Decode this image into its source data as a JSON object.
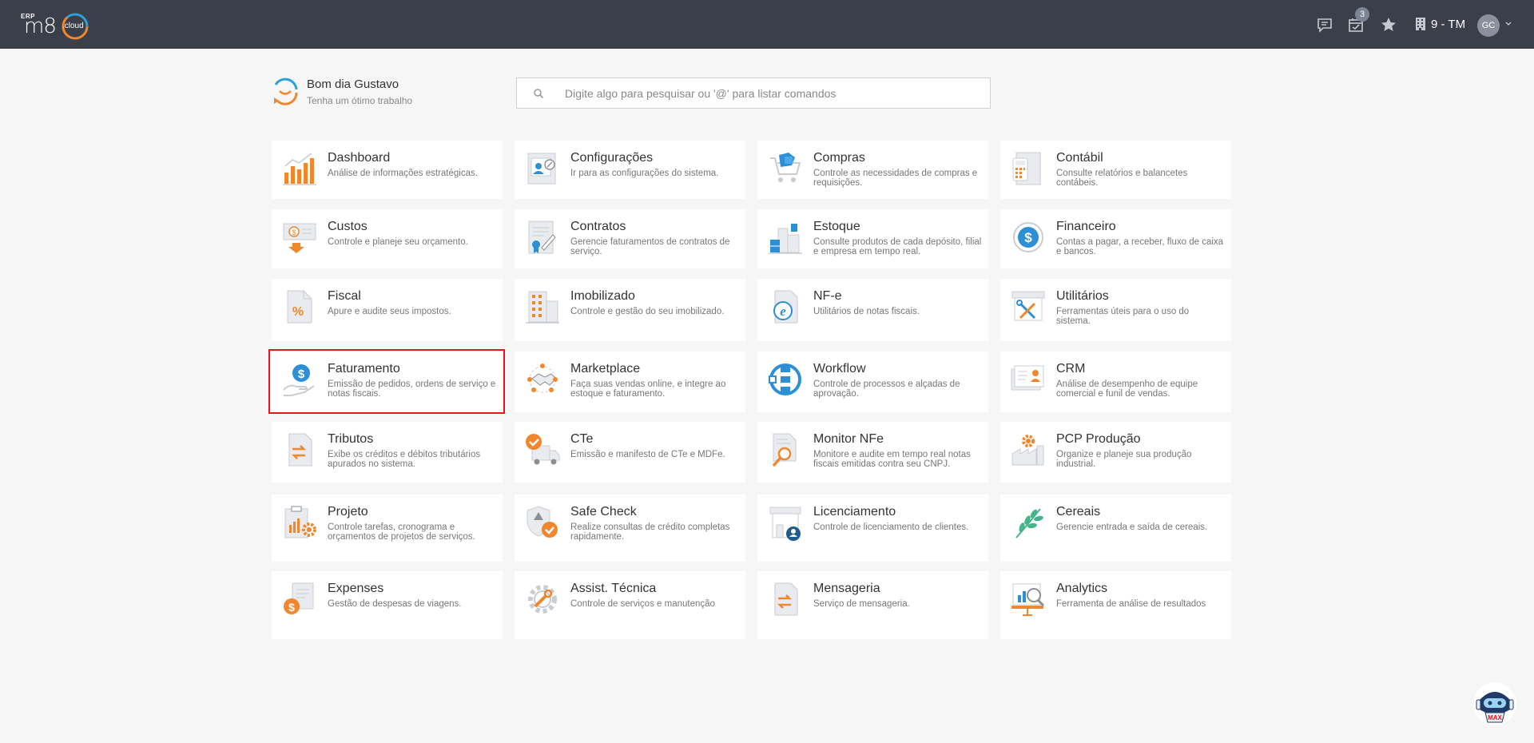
{
  "topbar": {
    "logo_erp": "ERP",
    "logo_name": "m8",
    "logo_cloud": ".cloud",
    "notification_count": "3",
    "company": "9 - TM",
    "avatar_initials": "GC",
    "background_color": "#3a3f4a"
  },
  "greeting": {
    "title": "Bom dia Gustavo",
    "subtitle": "Tenha um ótimo trabalho"
  },
  "search": {
    "placeholder": "Digite algo para pesquisar ou '@' para listar comandos"
  },
  "modules": [
    {
      "title": "Dashboard",
      "desc": "Análise de informações estratégicas.",
      "icon": "bar-chart-icon"
    },
    {
      "title": "Configurações",
      "desc": "Ir para as configurações do sistema.",
      "icon": "settings-doc-icon"
    },
    {
      "title": "Compras",
      "desc": "Controle as necessidades de compras e requisições.",
      "icon": "shopping-cart-icon"
    },
    {
      "title": "Contábil",
      "desc": "Consulte relatórios e balancetes contábeis.",
      "icon": "calculator-doc-icon"
    },
    {
      "title": "Custos",
      "desc": "Controle e planeje seu orçamento.",
      "icon": "money-down-icon"
    },
    {
      "title": "Contratos",
      "desc": "Gerencie faturamentos de contratos de serviço.",
      "icon": "contract-icon"
    },
    {
      "title": "Estoque",
      "desc": "Consulte produtos de cada depósito, filial e empresa em tempo real.",
      "icon": "warehouse-icon"
    },
    {
      "title": "Financeiro",
      "desc": "Contas a pagar, a receber, fluxo de caixa e bancos.",
      "icon": "dollar-circle-icon"
    },
    {
      "title": "Fiscal",
      "desc": "Apure e audite seus impostos.",
      "icon": "percent-doc-icon"
    },
    {
      "title": "Imobilizado",
      "desc": "Controle e gestão do seu imobilizado.",
      "icon": "building-icon"
    },
    {
      "title": "NF-e",
      "desc": "Utilitários de notas fiscais.",
      "icon": "e-doc-icon"
    },
    {
      "title": "Utilitários",
      "desc": "Ferramentas úteis para o uso do sistema.",
      "icon": "tools-icon"
    },
    {
      "title": "Faturamento",
      "desc": "Emissão de pedidos, ordens de serviço e notas fiscais.",
      "icon": "hand-dollar-icon"
    },
    {
      "title": "Marketplace",
      "desc": "Faça suas vendas online, e integre ao estoque e faturamento.",
      "icon": "handshake-icon"
    },
    {
      "title": "Workflow",
      "desc": "Controle de processos e alçadas de aprovação.",
      "icon": "workflow-icon"
    },
    {
      "title": "CRM",
      "desc": "Análise de desempenho de equipe comercial e funil de vendas.",
      "icon": "contact-card-icon"
    },
    {
      "title": "Tributos",
      "desc": "Exibe os créditos e débitos tributários apurados no sistema.",
      "icon": "exchange-doc-icon"
    },
    {
      "title": "CTe",
      "desc": "Emissão e manifesto de CTe e MDFe.",
      "icon": "truck-check-icon"
    },
    {
      "title": "Monitor NFe",
      "desc": "Monitore e audite em tempo real notas fiscais emitidas contra seu CNPJ.",
      "icon": "magnifier-doc-icon"
    },
    {
      "title": "PCP Produção",
      "desc": "Organize e planeje sua produção industrial.",
      "icon": "factory-gear-icon"
    },
    {
      "title": "Projeto",
      "desc": "Controle tarefas, cronograma e orçamentos de projetos de serviços.",
      "icon": "clipboard-gear-icon"
    },
    {
      "title": "Safe Check",
      "desc": "Realize consultas de crédito completas rapidamente.",
      "icon": "shield-check-icon"
    },
    {
      "title": "Licenciamento",
      "desc": "Controle de licenciamento de clientes.",
      "icon": "store-user-icon"
    },
    {
      "title": "Cereais",
      "desc": "Gerencie entrada e saída de cereais.",
      "icon": "wheat-icon"
    },
    {
      "title": "Expenses",
      "desc": "Gestão de despesas de viagens.",
      "icon": "expense-doc-icon"
    },
    {
      "title": "Assist. Técnica",
      "desc": "Controle de serviços e manutenção",
      "icon": "gear-wrench-icon"
    },
    {
      "title": "Mensageria",
      "desc": "Serviço de mensageria.",
      "icon": "message-doc-icon"
    },
    {
      "title": "Analytics",
      "desc": "Ferramenta de análise de resultados",
      "icon": "analytics-board-icon"
    }
  ],
  "selected_module": "Faturamento",
  "assistant": {
    "label": "MAX"
  }
}
